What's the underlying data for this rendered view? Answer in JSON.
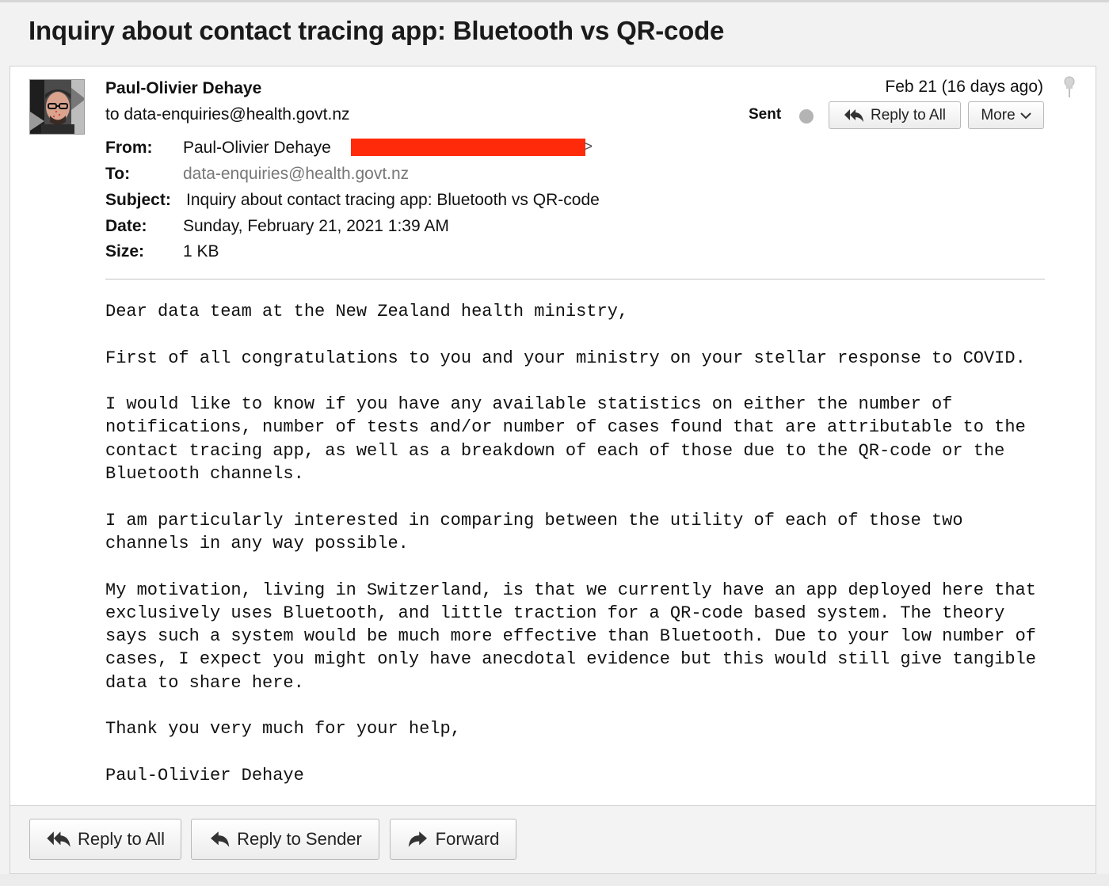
{
  "email": {
    "subject_title": "Inquiry about contact tracing app: Bluetooth vs QR-code",
    "sender_name": "Paul-Olivier Dehaye",
    "to_summary": "to data-enquiries@health.govt.nz",
    "date_short": "Feb 21 (16 days ago)",
    "status_label": "Sent",
    "buttons": {
      "reply_all_top": "Reply to All",
      "more": "More",
      "reply_all_bottom": "Reply to All",
      "reply_sender": "Reply to Sender",
      "forward": "Forward"
    },
    "headers": {
      "from_label": "From:",
      "from_value": "Paul-Olivier Dehaye",
      "from_tail": ">",
      "to_label": "To:",
      "to_value": "data-enquiries@health.govt.nz",
      "subject_label": "Subject:",
      "subject_value": "Inquiry about contact tracing app: Bluetooth vs QR-code",
      "date_label": "Date:",
      "date_value": "Sunday, February 21, 2021 1:39 AM",
      "size_label": "Size:",
      "size_value": "1 KB"
    },
    "body": "Dear data team at the New Zealand health ministry,\n\nFirst of all congratulations to you and your ministry on your stellar response to COVID.\n\nI would like to know if you have any available statistics on either the number of\nnotifications, number of tests and/or number of cases found that are attributable to the\ncontact tracing app, as well as a breakdown of each of those due to the QR-code or the\nBluetooth channels.\n\nI am particularly interested in comparing between the utility of each of those two\nchannels in any way possible.\n\nMy motivation, living in Switzerland, is that we currently have an app deployed here that\nexclusively uses Bluetooth, and little traction for a QR-code based system. The theory\nsays such a system would be much more effective than Bluetooth. Due to your low number of\ncases, I expect you might only have anecdotal evidence but this would still give tangible\ndata to share here.\n\nThank you very much for your help,\n\nPaul-Olivier Dehaye"
  },
  "icons": {
    "reply_all": "reply-all-icon",
    "reply": "reply-icon",
    "forward": "forward-icon",
    "more_chevron": "chevron-down-icon",
    "pin": "pin-icon",
    "status_dot": "status-dot"
  },
  "colors": {
    "redaction": "#ff2a0a",
    "status_dot": "#b4b4b4",
    "to_value": "#777777"
  }
}
